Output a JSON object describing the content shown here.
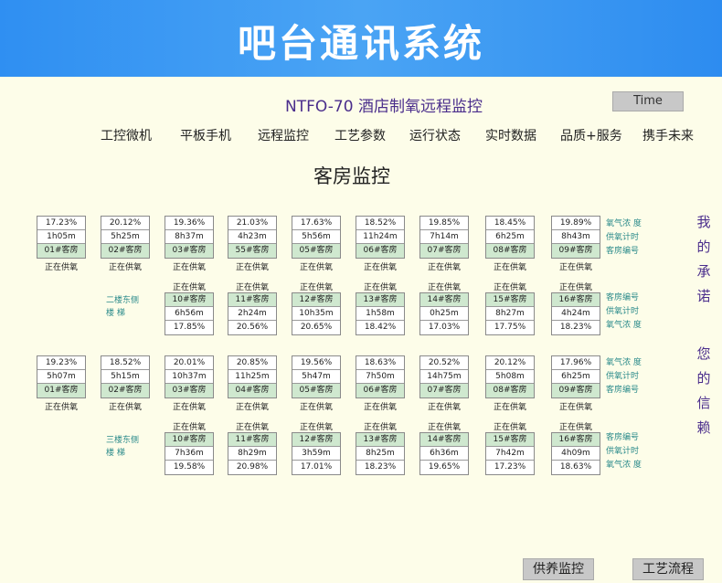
{
  "banner": {
    "title": "吧台通讯系统"
  },
  "header": {
    "system_title": "NTFO-70  酒店制氧远程监控",
    "time_button": "Time"
  },
  "nav": [
    "工控微机",
    "平板手机",
    "远程监控",
    "工艺参数",
    "运行状态",
    "实时数据",
    "品质+服务",
    "携手未来"
  ],
  "section_title": "客房监控",
  "status_text": "正在供氧",
  "legend": {
    "concentration": "氧气浓 度",
    "timer": "供氧计时",
    "room_no": "客房编号"
  },
  "floor2": {
    "stairs": [
      "二楼东侧",
      "楼    梯"
    ],
    "top_rooms": [
      {
        "pct": "17.23%",
        "time": "1h05m",
        "room": "01#客房"
      },
      {
        "pct": "20.12%",
        "time": "5h25m",
        "room": "02#客房"
      },
      {
        "pct": "19.36%",
        "time": "8h37m",
        "room": "03#客房"
      },
      {
        "pct": "21.03%",
        "time": "4h23m",
        "room": "55#客房"
      },
      {
        "pct": "17.63%",
        "time": "5h56m",
        "room": "05#客房"
      },
      {
        "pct": "18.52%",
        "time": "11h24m",
        "room": "06#客房"
      },
      {
        "pct": "19.85%",
        "time": "7h14m",
        "room": "07#客房"
      },
      {
        "pct": "18.45%",
        "time": "6h25m",
        "room": "08#客房"
      },
      {
        "pct": "19.89%",
        "time": "8h43m",
        "room": "09#客房"
      }
    ],
    "bottom_rooms": [
      {
        "room": "10#客房",
        "time": "6h56m",
        "pct": "17.85%"
      },
      {
        "room": "11#客房",
        "time": "2h24m",
        "pct": "20.56%"
      },
      {
        "room": "12#客房",
        "time": "10h35m",
        "pct": "20.65%"
      },
      {
        "room": "13#客房",
        "time": "1h58m",
        "pct": "18.42%"
      },
      {
        "room": "14#客房",
        "time": "0h25m",
        "pct": "17.03%"
      },
      {
        "room": "15#客房",
        "time": "8h27m",
        "pct": "17.75%"
      },
      {
        "room": "16#客房",
        "time": "4h24m",
        "pct": "18.23%"
      }
    ]
  },
  "floor3": {
    "stairs": [
      "三楼东侧",
      "楼    梯"
    ],
    "top_rooms": [
      {
        "pct": "19.23%",
        "time": "5h07m",
        "room": "01#客房"
      },
      {
        "pct": "18.52%",
        "time": "5h15m",
        "room": "02#客房"
      },
      {
        "pct": "20.01%",
        "time": "10h37m",
        "room": "03#客房"
      },
      {
        "pct": "20.85%",
        "time": "11h25m",
        "room": "04#客房"
      },
      {
        "pct": "19.56%",
        "time": "5h47m",
        "room": "05#客房"
      },
      {
        "pct": "18.63%",
        "time": "7h50m",
        "room": "06#客房"
      },
      {
        "pct": "20.52%",
        "time": "14h75m",
        "room": "07#客房"
      },
      {
        "pct": "20.12%",
        "time": "5h08m",
        "room": "08#客房"
      },
      {
        "pct": "17.96%",
        "time": "6h25m",
        "room": "09#客房"
      }
    ],
    "bottom_rooms": [
      {
        "room": "10#客房",
        "time": "7h36m",
        "pct": "19.58%"
      },
      {
        "room": "11#客房",
        "time": "8h29m",
        "pct": "20.98%"
      },
      {
        "room": "12#客房",
        "time": "3h59m",
        "pct": "17.01%"
      },
      {
        "room": "13#客房",
        "time": "8h25m",
        "pct": "18.23%"
      },
      {
        "room": "14#客房",
        "time": "6h36m",
        "pct": "19.65%"
      },
      {
        "room": "15#客房",
        "time": "7h42m",
        "pct": "17.23%"
      },
      {
        "room": "16#客房",
        "time": "4h09m",
        "pct": "18.63%"
      }
    ]
  },
  "slogan": {
    "line1": [
      "我",
      "的",
      "承",
      "诺"
    ],
    "line2": [
      "您",
      "的",
      "信",
      "赖"
    ]
  },
  "bottom_buttons": {
    "supply_monitor": "供养监控",
    "process_flow": "工艺流程"
  }
}
